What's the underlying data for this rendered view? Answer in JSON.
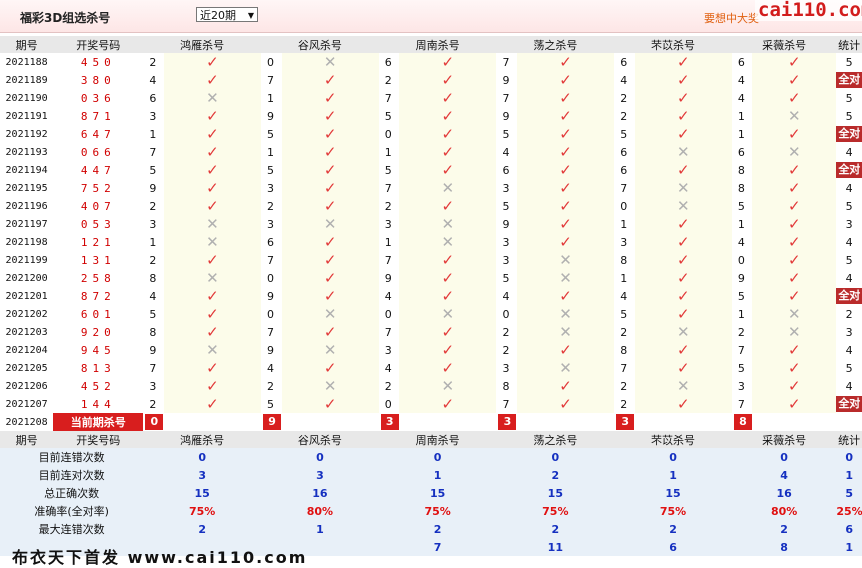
{
  "header": {
    "title": "福彩3D组选杀号",
    "select_value": "近20期",
    "promo": "要想中大奖",
    "watermark": "cai110.com"
  },
  "columns": {
    "period": "期号",
    "draw": "开奖号码",
    "experts": [
      "鸿雁杀号",
      "谷风杀号",
      "周南杀号",
      "荡之杀号",
      "芣苡杀号",
      "采薇杀号"
    ],
    "stat": "统计"
  },
  "rows": [
    {
      "period": "2021188",
      "draw": "450",
      "picks": [
        2,
        0,
        6,
        7,
        6,
        6
      ],
      "marks": [
        1,
        0,
        1,
        1,
        1,
        1
      ],
      "stat": "5"
    },
    {
      "period": "2021189",
      "draw": "380",
      "picks": [
        4,
        7,
        2,
        9,
        4,
        4
      ],
      "marks": [
        1,
        1,
        1,
        1,
        1,
        1
      ],
      "stat": "全对"
    },
    {
      "period": "2021190",
      "draw": "036",
      "picks": [
        6,
        1,
        7,
        7,
        2,
        4
      ],
      "marks": [
        0,
        1,
        1,
        1,
        1,
        1
      ],
      "stat": "5"
    },
    {
      "period": "2021191",
      "draw": "871",
      "picks": [
        3,
        9,
        5,
        9,
        2,
        1
      ],
      "marks": [
        1,
        1,
        1,
        1,
        1,
        0
      ],
      "stat": "5"
    },
    {
      "period": "2021192",
      "draw": "647",
      "picks": [
        1,
        5,
        0,
        5,
        5,
        1
      ],
      "marks": [
        1,
        1,
        1,
        1,
        1,
        1
      ],
      "stat": "全对"
    },
    {
      "period": "2021193",
      "draw": "066",
      "picks": [
        7,
        1,
        1,
        4,
        6,
        6
      ],
      "marks": [
        1,
        1,
        1,
        1,
        0,
        0
      ],
      "stat": "4"
    },
    {
      "period": "2021194",
      "draw": "447",
      "picks": [
        5,
        5,
        5,
        6,
        6,
        8
      ],
      "marks": [
        1,
        1,
        1,
        1,
        1,
        1
      ],
      "stat": "全对"
    },
    {
      "period": "2021195",
      "draw": "752",
      "picks": [
        9,
        3,
        7,
        3,
        7,
        8
      ],
      "marks": [
        1,
        1,
        0,
        1,
        0,
        1
      ],
      "stat": "4"
    },
    {
      "period": "2021196",
      "draw": "407",
      "picks": [
        2,
        2,
        2,
        5,
        0,
        5
      ],
      "marks": [
        1,
        1,
        1,
        1,
        0,
        1
      ],
      "stat": "5"
    },
    {
      "period": "2021197",
      "draw": "053",
      "picks": [
        3,
        3,
        3,
        9,
        1,
        1
      ],
      "marks": [
        0,
        0,
        0,
        1,
        1,
        1
      ],
      "stat": "3"
    },
    {
      "period": "2021198",
      "draw": "121",
      "picks": [
        1,
        6,
        1,
        3,
        3,
        4
      ],
      "marks": [
        0,
        1,
        0,
        1,
        1,
        1
      ],
      "stat": "4"
    },
    {
      "period": "2021199",
      "draw": "131",
      "picks": [
        2,
        7,
        7,
        3,
        8,
        0
      ],
      "marks": [
        1,
        1,
        1,
        0,
        1,
        1
      ],
      "stat": "5"
    },
    {
      "period": "2021200",
      "draw": "258",
      "picks": [
        8,
        0,
        9,
        5,
        1,
        9
      ],
      "marks": [
        0,
        1,
        1,
        0,
        1,
        1
      ],
      "stat": "4"
    },
    {
      "period": "2021201",
      "draw": "872",
      "picks": [
        4,
        9,
        4,
        4,
        4,
        5
      ],
      "marks": [
        1,
        1,
        1,
        1,
        1,
        1
      ],
      "stat": "全对"
    },
    {
      "period": "2021202",
      "draw": "601",
      "picks": [
        5,
        0,
        0,
        0,
        5,
        1
      ],
      "marks": [
        1,
        0,
        0,
        0,
        1,
        0
      ],
      "stat": "2"
    },
    {
      "period": "2021203",
      "draw": "920",
      "picks": [
        8,
        7,
        7,
        2,
        2,
        2
      ],
      "marks": [
        1,
        1,
        1,
        0,
        0,
        0
      ],
      "stat": "3"
    },
    {
      "period": "2021204",
      "draw": "945",
      "picks": [
        9,
        9,
        3,
        2,
        8,
        7
      ],
      "marks": [
        0,
        0,
        1,
        1,
        1,
        1
      ],
      "stat": "4"
    },
    {
      "period": "2021205",
      "draw": "813",
      "picks": [
        7,
        4,
        4,
        3,
        7,
        5
      ],
      "marks": [
        1,
        1,
        1,
        0,
        1,
        1
      ],
      "stat": "5"
    },
    {
      "period": "2021206",
      "draw": "452",
      "picks": [
        3,
        2,
        2,
        8,
        2,
        3
      ],
      "marks": [
        1,
        0,
        0,
        1,
        0,
        1
      ],
      "stat": "4"
    },
    {
      "period": "2021207",
      "draw": "144",
      "picks": [
        2,
        5,
        0,
        7,
        2,
        7
      ],
      "marks": [
        1,
        1,
        1,
        1,
        1,
        1
      ],
      "stat": "全对"
    }
  ],
  "current": {
    "period": "2021208",
    "label": "当前期杀号",
    "values": [
      "0",
      "9",
      "3",
      "3",
      "3",
      "8"
    ]
  },
  "stats": [
    {
      "label": "目前连错次数",
      "values": [
        "0",
        "0",
        "0",
        "0",
        "0",
        "0"
      ],
      "total": "0",
      "red": false
    },
    {
      "label": "目前连对次数",
      "values": [
        "3",
        "3",
        "1",
        "2",
        "1",
        "4"
      ],
      "total": "1",
      "red": false
    },
    {
      "label": "总正确次数",
      "values": [
        "15",
        "16",
        "15",
        "15",
        "15",
        "16"
      ],
      "total": "5",
      "red": false
    },
    {
      "label": "准确率(全对率)",
      "values": [
        "75%",
        "80%",
        "75%",
        "75%",
        "75%",
        "80%"
      ],
      "total": "25%",
      "red": true
    },
    {
      "label": "最大连错次数",
      "values": [
        "2",
        "1",
        "2",
        "2",
        "2",
        "2"
      ],
      "total": "6",
      "red": false
    },
    {
      "label": "",
      "values": [
        "",
        "",
        "7",
        "11",
        "6",
        "8"
      ],
      "total": "1",
      "red": false
    }
  ],
  "footer": "布衣天下首发 www.cai110.com",
  "icons": {
    "ok": "check-icon",
    "no": "cross-icon"
  },
  "colors": {
    "accent": "#d81e1e",
    "ok": "#e23a3a",
    "no": "#b0b0b0",
    "stat_blue": "#1530c0"
  }
}
